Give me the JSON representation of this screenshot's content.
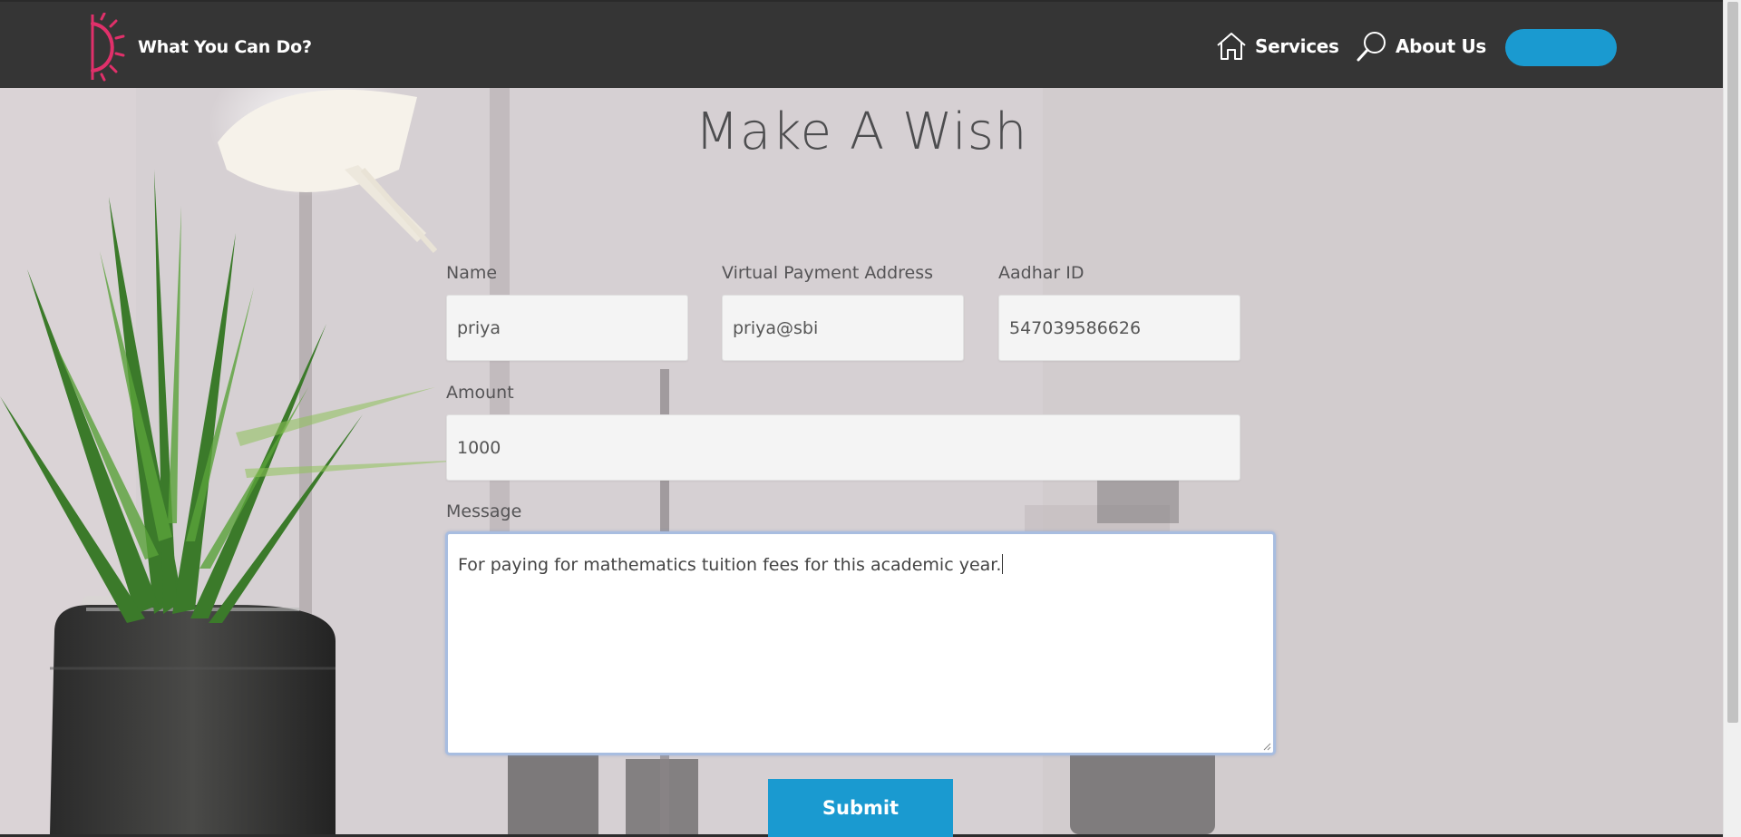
{
  "header": {
    "brand_name": "What You Can Do?",
    "nav": [
      {
        "label": "Services",
        "icon": "home-icon"
      },
      {
        "label": "About Us",
        "icon": "search-icon"
      }
    ],
    "pill_button_label": "",
    "brand_color": "#e0306a",
    "accent_color": "#1a9ad0"
  },
  "form": {
    "title": "Make A Wish",
    "fields": {
      "name": {
        "label": "Name",
        "value": "priya"
      },
      "vpa": {
        "label": "Virtual Payment Address",
        "value": "priya@sbi"
      },
      "aadhar": {
        "label": "Aadhar ID",
        "value": "547039586626"
      },
      "amount": {
        "label": "Amount",
        "value": "1000"
      },
      "message": {
        "label": "Message",
        "value": "For paying for mathematics tuition fees for this academic year."
      }
    },
    "submit_label": "Submit"
  }
}
